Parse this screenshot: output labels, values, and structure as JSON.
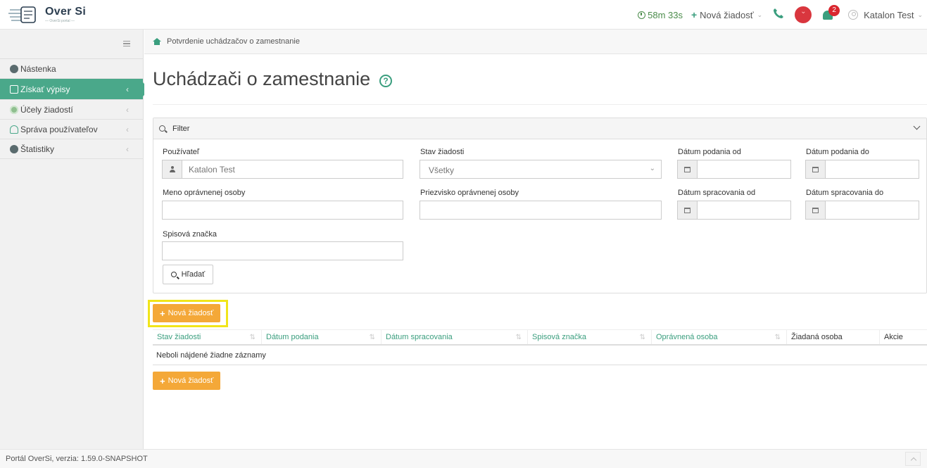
{
  "header": {
    "logo_name": "Over Si",
    "logo_tagline": "— OverSi portal —",
    "timer": "58m 33s",
    "new_request": "Nová žiadosť",
    "notifications_count": "2",
    "user_name": "Katalon Test"
  },
  "sidebar": {
    "items": [
      {
        "label": "Nástenka",
        "icon": "dashboard-icon"
      },
      {
        "label": "Získať výpisy",
        "icon": "copy-icon",
        "active": true
      },
      {
        "label": "Účely žiadostí",
        "icon": "circle-icon"
      },
      {
        "label": "Správa používateľov",
        "icon": "users-icon"
      },
      {
        "label": "Štatistiky",
        "icon": "dashboard-icon"
      }
    ]
  },
  "breadcrumb": "Potvrdenie uchádzačov o zamestnanie",
  "page": {
    "title": "Uchádzači o zamestnanie",
    "help": "?"
  },
  "filter": {
    "title": "Filter",
    "user_label": "Používateľ",
    "user_value": "Katalon Test",
    "status_label": "Stav žiadosti",
    "status_value": "Všetky",
    "submitted_from_label": "Dátum podania od",
    "submitted_to_label": "Dátum podania do",
    "name_label": "Meno oprávnenej osoby",
    "surname_label": "Priezvisko oprávnenej osoby",
    "processed_from_label": "Dátum spracovania od",
    "processed_to_label": "Dátum spracovania do",
    "file_ref_label": "Spisová značka",
    "search_button": "Hľadať"
  },
  "actions": {
    "new_request_button": "Nová žiadosť"
  },
  "table": {
    "columns": [
      "Stav žiadosti",
      "Dátum podania",
      "Dátum spracovania",
      "Spisová značka",
      "Oprávnená osoba",
      "Žiadaná osoba",
      "Akcie"
    ],
    "empty_message": "Neboli nájdené žiadne záznamy"
  },
  "footer": {
    "version": "Portál OverSi, verzia: 1.59.0-SNAPSHOT"
  },
  "colors": {
    "accent": "#4aa88a",
    "orange": "#f4a838",
    "notification": "#d9262e",
    "highlight": "#f1e51a"
  }
}
